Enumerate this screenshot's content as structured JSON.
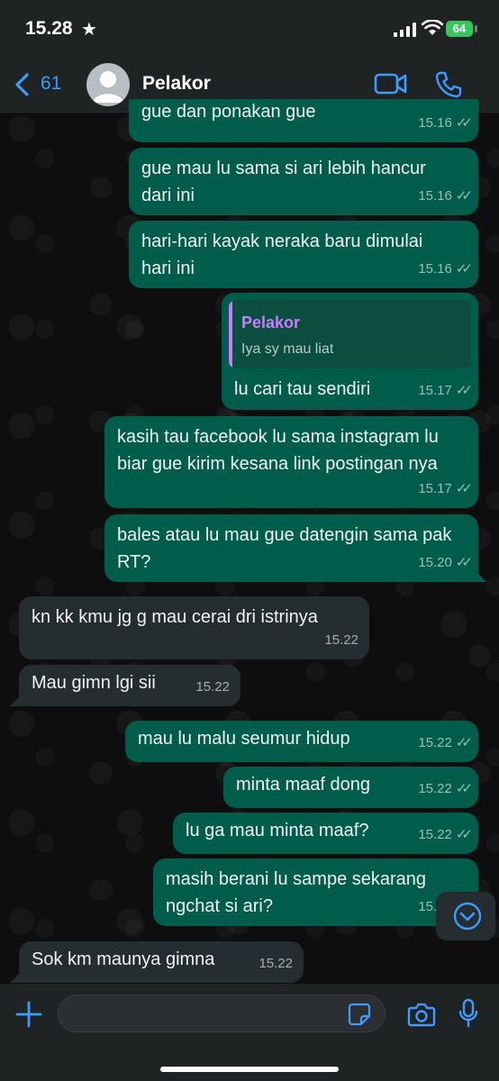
{
  "status_bar": {
    "time": "15.28",
    "battery": "64"
  },
  "header": {
    "back_count": "61",
    "contact_name": "Pelakor"
  },
  "messages": [
    {
      "text": "gue dan ponakan gue",
      "time": "15.16"
    },
    {
      "text": "gue mau lu sama si ari lebih hancur dari ini",
      "time": "15.16"
    },
    {
      "text": "hari-hari kayak neraka baru dimulai hari ini",
      "time": "15.16"
    },
    {
      "quote_author": "Pelakor",
      "quote_text": "Iya sy mau liat",
      "text": "lu cari tau sendiri",
      "time": "15.17"
    },
    {
      "text": "kasih tau facebook lu sama instagram lu biar gue kirim kesana link postingan nya",
      "time": "15.17"
    },
    {
      "text": "bales atau lu mau gue datengin sama pak RT?",
      "time": "15.20"
    },
    {
      "text": "kn kk kmu jg g mau cerai dri istrinya",
      "time": "15.22"
    },
    {
      "text": "Mau gimn lgi sii",
      "time": "15.22"
    },
    {
      "text": "mau lu malu seumur hidup",
      "time": "15.22"
    },
    {
      "text": "minta maaf dong",
      "time": "15.22"
    },
    {
      "text": "lu ga mau minta maaf?",
      "time": "15.22"
    },
    {
      "text": "masih berani lu sampe sekarang ngchat si ari?",
      "time": "15.22"
    },
    {
      "text": "Sok km maunya gimna",
      "time": "15.22"
    }
  ],
  "colors": {
    "outgoing": "#005c4b",
    "incoming": "#262d31",
    "accent": "#3e9bff",
    "quote_author": "#c77dff"
  },
  "icons": [
    "back-chevron-icon",
    "video-call-icon",
    "phone-call-icon",
    "plus-icon",
    "sticker-icon",
    "camera-icon",
    "microphone-icon",
    "chevron-down-icon"
  ]
}
